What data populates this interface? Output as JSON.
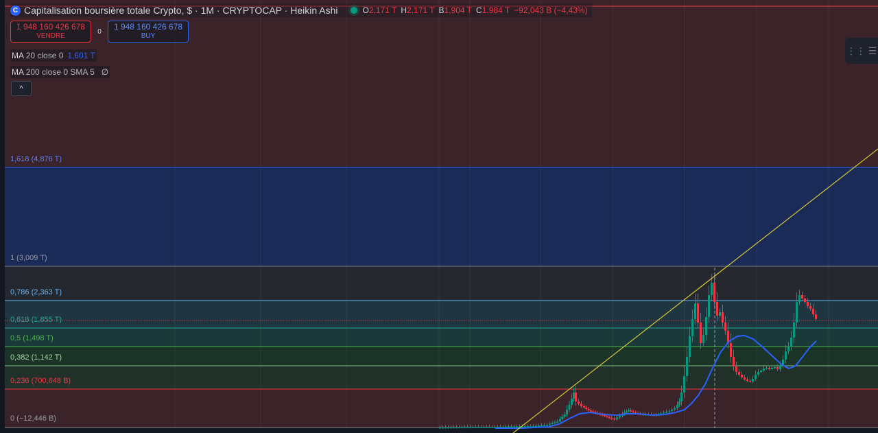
{
  "header": {
    "title": "Capitalisation boursière totale Crypto, $ · 1M · CRYPTOCAP · Heikin Ashi",
    "ohlc": {
      "o_label": "O",
      "o_value": "2,171 T",
      "h_label": "H",
      "h_value": "2,171 T",
      "b_label": "B",
      "b_value": "1,904 T",
      "c_label": "C",
      "c_value": "1,984 T",
      "change": "−92,043 B (−4,43%)"
    }
  },
  "trade": {
    "sell_price": "1 948 160 426 678",
    "sell_label": "VENDRE",
    "spread": "0",
    "buy_price": "1 948 160 426 678",
    "buy_label": "BUY"
  },
  "indicators": {
    "ma20_name": "MA",
    "ma20_params": "20 close 0",
    "ma20_value": "1,601 T",
    "ma200_name": "MA",
    "ma200_params": "200 close 0 SMA 5",
    "ma200_value": "∅"
  },
  "collapse_icon": "chevron-up",
  "fib": {
    "l1618": "1,618 (4,876 T)",
    "l1": "1 (3,009 T)",
    "l0786": "0,786 (2,363 T)",
    "l0618": "0,618 (1,855 T)",
    "l05": "0,5 (1,498 T)",
    "l0382": "0,382 (1,142 T)",
    "l0236": "0,236 (700,648 B)",
    "l0": "0 (−12,446 B)"
  },
  "colors": {
    "bull": "#089981",
    "bear": "#f23645",
    "ma": "#2962ff",
    "trendline": "#d8c83a"
  }
}
